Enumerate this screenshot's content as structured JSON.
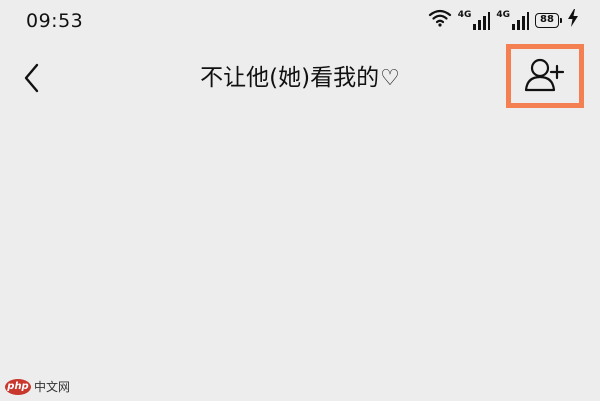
{
  "status_bar": {
    "time": "09:53",
    "network_1": "4G",
    "network_2": "4G",
    "battery": "88"
  },
  "header": {
    "title": "不让他(她)看我的",
    "title_suffix_icon": "heart-icon",
    "back_icon": "chevron-left-icon",
    "action_icon": "add-user-icon",
    "highlight_color": "#f47f50"
  },
  "watermark": {
    "logo": "php",
    "text": "中文网"
  }
}
